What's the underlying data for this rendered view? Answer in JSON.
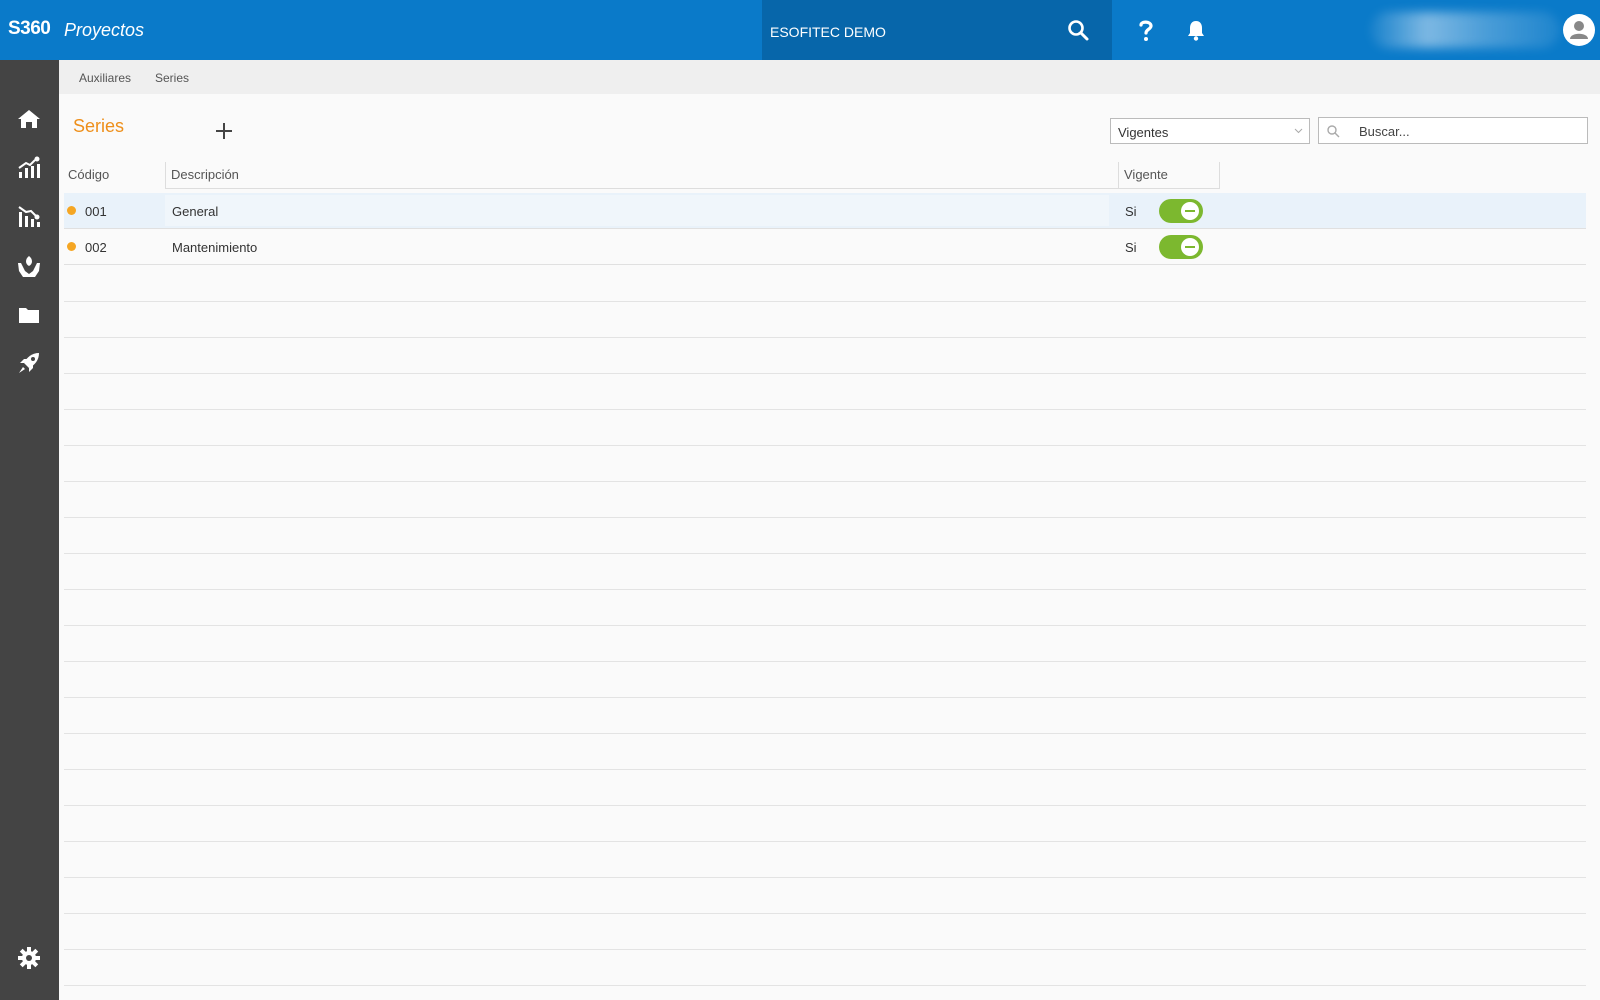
{
  "header": {
    "brand": "S360",
    "module": "Proyectos",
    "company": "ESOFITEC DEMO",
    "colors": {
      "bar": "#0a7ac9",
      "company_bg": "#0766aa"
    }
  },
  "sidebar": {
    "items": [
      {
        "icon": "home-icon"
      },
      {
        "icon": "chart-growth-icon"
      },
      {
        "icon": "chart-decline-icon"
      },
      {
        "icon": "hands-leaf-icon"
      },
      {
        "icon": "folder-icon"
      },
      {
        "icon": "rocket-icon"
      }
    ],
    "footer_icon": "gear-icon",
    "color": "#444444"
  },
  "breadcrumb": {
    "items": [
      "Auxiliares",
      "Series"
    ]
  },
  "page": {
    "title": "Series",
    "title_color": "#ee8f1a"
  },
  "filter": {
    "selected": "Vigentes"
  },
  "search": {
    "placeholder": "Buscar..."
  },
  "table": {
    "columns": [
      "Código",
      "Descripción",
      "Vigente"
    ],
    "rows": [
      {
        "code": "001",
        "description": "General",
        "vigente": "Si",
        "active": true
      },
      {
        "code": "002",
        "description": "Mantenimiento",
        "vigente": "Si",
        "active": true
      }
    ],
    "status_dot_color": "#f5a623",
    "toggle_color": "#7cb82f"
  }
}
